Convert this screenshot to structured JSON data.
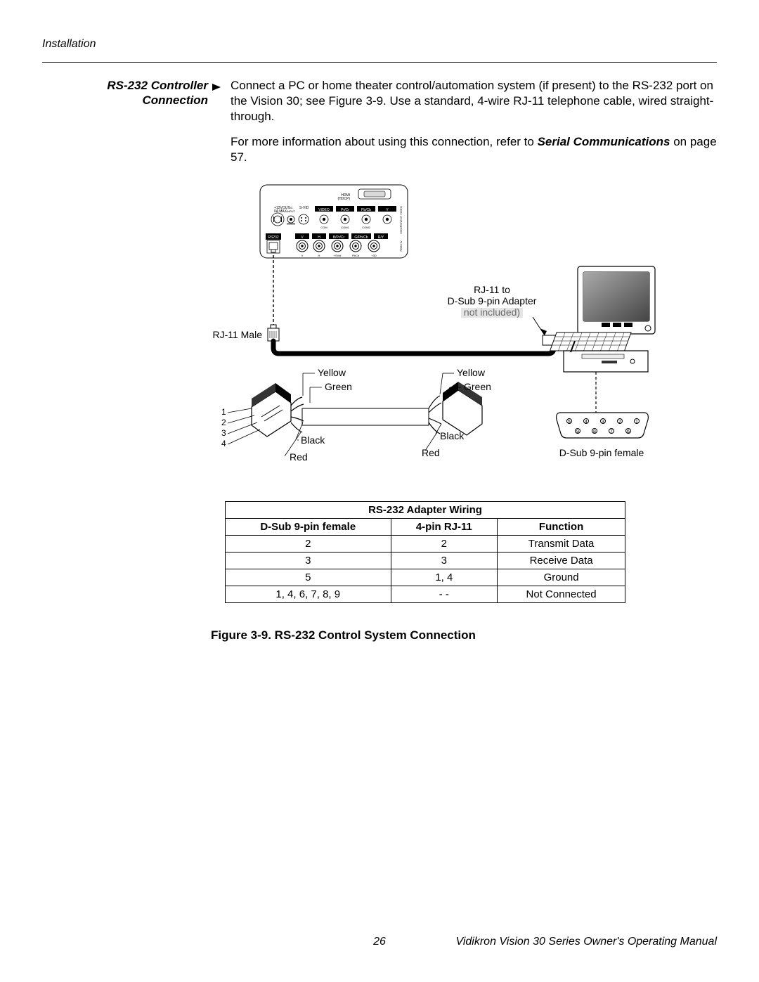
{
  "header": {
    "section": "Installation"
  },
  "section": {
    "heading_line1": "RS-232 Controller",
    "heading_line2": "Connection",
    "para1_a": "Connect a PC or home theater control/automation system (if present) to the RS-232 port on the Vision 30; see Figure 3-9. Use a standard, 4-wire RJ-11 telephone cable, wired straight-through.",
    "para2_a": "For more information about using this connection, refer to ",
    "para2_b": "Serial Communications",
    "para2_c": " on page 57."
  },
  "diagram_labels": {
    "rj11_male": "RJ-11 Male",
    "adapter_l1": "RJ-11 to",
    "adapter_l2": "D-Sub 9-pin Adapter",
    "adapter_l3": "not included)",
    "yellow_l": "Yellow",
    "green_l": "Green",
    "black_l": "Black",
    "red_l": "Red",
    "yellow_r": "Yellow",
    "green_r": "Green",
    "black_r": "Black",
    "red_r": "Red",
    "pin1": "1",
    "pin2": "2",
    "pin3": "3",
    "pin4": "4",
    "dsub_female": "D-Sub 9-pin female"
  },
  "table": {
    "title": "RS-232 Adapter Wiring",
    "col1": "D-Sub 9-pin female",
    "col2": "4-pin RJ-11",
    "col3": "Function",
    "rows": [
      {
        "a": "2",
        "b": "2",
        "c": "Transmit Data"
      },
      {
        "a": "3",
        "b": "3",
        "c": "Receive Data"
      },
      {
        "a": "5",
        "b": "1, 4",
        "c": "Ground"
      },
      {
        "a": "1, 4, 6, 7, 8, 9",
        "b": "- -",
        "c": "Not Connected"
      }
    ]
  },
  "figure_caption": "Figure 3-9. RS-232 Control System Connection",
  "footer": {
    "page": "26",
    "manual": "Vidikron Vision 30 Series Owner's Operating Manual"
  }
}
